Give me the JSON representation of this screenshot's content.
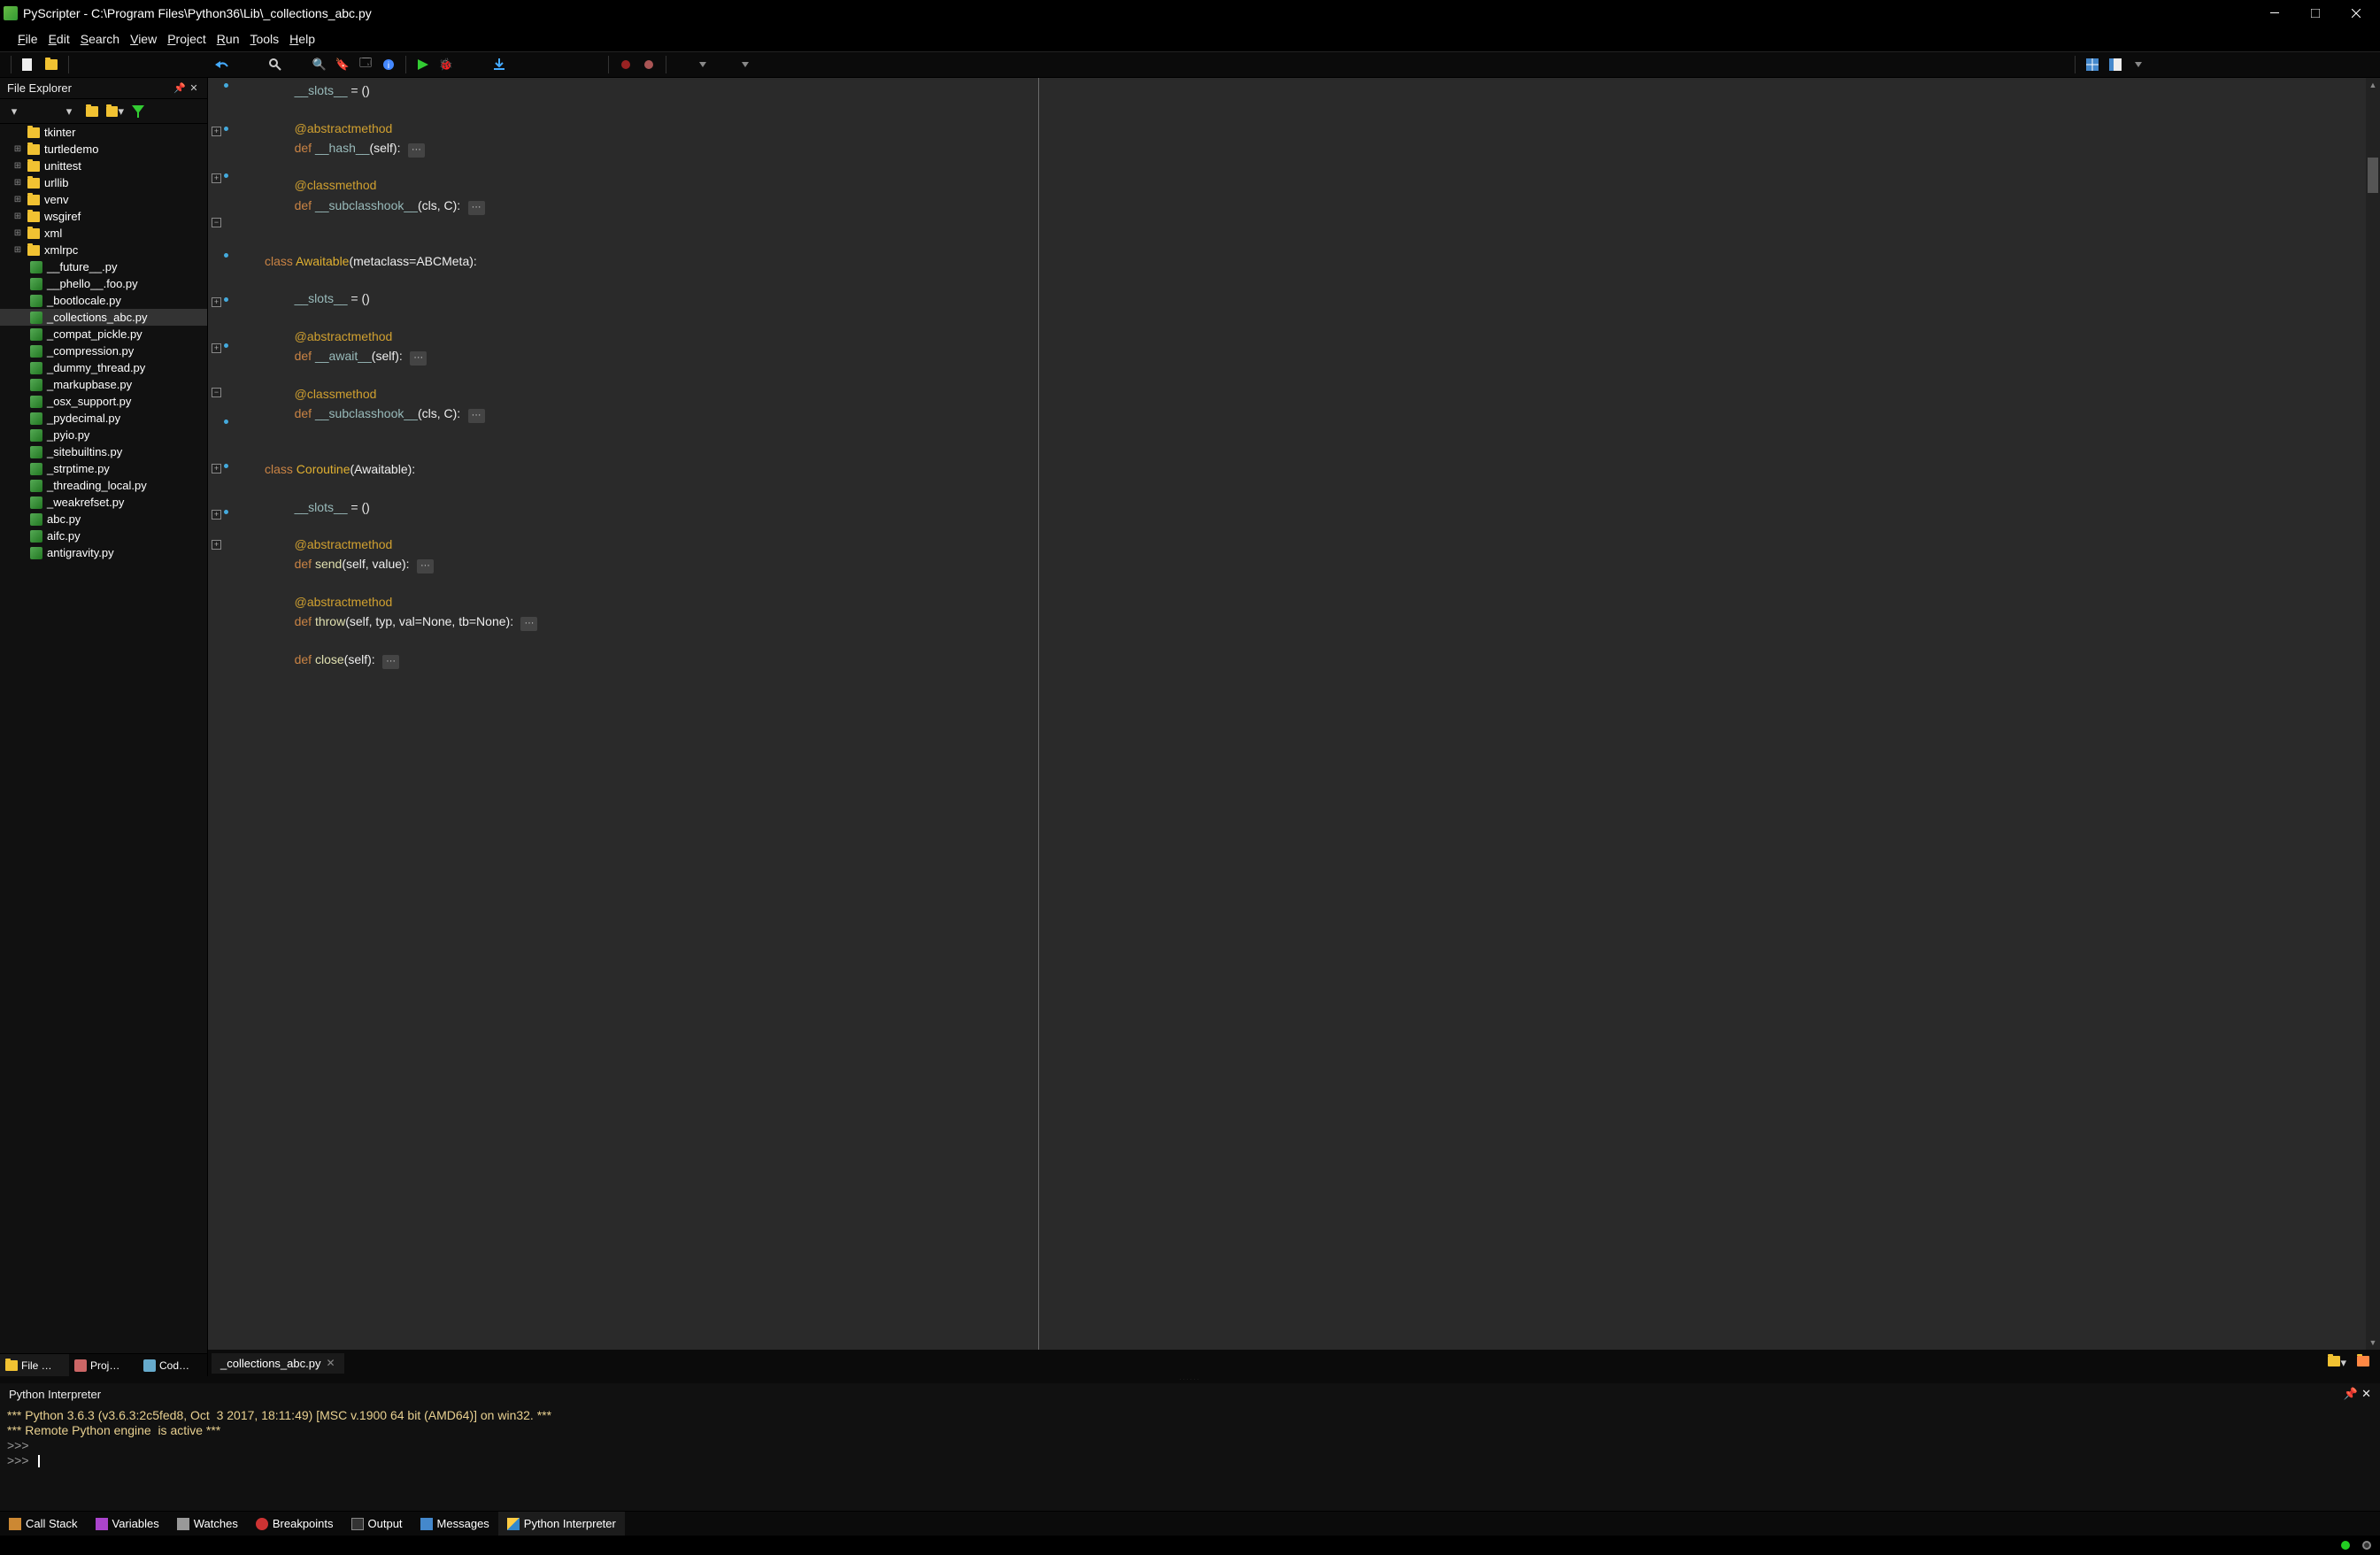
{
  "title": "PyScripter - C:\\Program Files\\Python36\\Lib\\_collections_abc.py",
  "menus": [
    "File",
    "Edit",
    "Search",
    "View",
    "Project",
    "Run",
    "Tools",
    "Help"
  ],
  "file_explorer": {
    "title": "File Explorer",
    "folders": [
      "tkinter",
      "turtledemo",
      "unittest",
      "urllib",
      "venv",
      "wsgiref",
      "xml",
      "xmlrpc"
    ],
    "files": [
      "__future__.py",
      "__phello__.foo.py",
      "_bootlocale.py",
      "_collections_abc.py",
      "_compat_pickle.py",
      "_compression.py",
      "_dummy_thread.py",
      "_markupbase.py",
      "_osx_support.py",
      "_pydecimal.py",
      "_pyio.py",
      "_sitebuiltins.py",
      "_strptime.py",
      "_threading_local.py",
      "_weakrefset.py",
      "abc.py",
      "aifc.py",
      "antigravity.py"
    ],
    "selected": "_collections_abc.py"
  },
  "panel_tabs": [
    {
      "label": "File …",
      "active": true
    },
    {
      "label": "Proj…",
      "active": false
    },
    {
      "label": "Cod…",
      "active": false
    }
  ],
  "editor_tab": {
    "label": "_collections_abc.py"
  },
  "interp": {
    "title": "Python Interpreter",
    "line1": "*** Python 3.6.3 (v3.6.3:2c5fed8, Oct  3 2017, 18:11:49) [MSC v.1900 64 bit (AMD64)] on win32. ***",
    "line2": "*** Remote Python engine  is active ***",
    "prompt": ">>>"
  },
  "bottom_tabs": [
    "Call Stack",
    "Variables",
    "Watches",
    "Breakpoints",
    "Output",
    "Messages",
    "Python Interpreter"
  ],
  "code": {
    "slots": "__slots__",
    "eq": " = ()",
    "abstractmethod": "@abstractmethod",
    "classmethod": "@classmethod",
    "def": "def ",
    "hash": "__hash__",
    "subclasshook": "__subclasshook__",
    "await": "__await__",
    "send": "send",
    "throw": "throw",
    "close": "close",
    "args_self": "(self):",
    "args_cls": "(cls, C):",
    "args_selfvalue": "(self, value):",
    "args_throw": "(self, typ, val=None, tb=None):",
    "class": "class ",
    "awaitable": "Awaitable",
    "awaitable_args": "(metaclass=ABCMeta):",
    "coroutine": "Coroutine",
    "coroutine_args": "(Awaitable):",
    "fold": "···"
  }
}
